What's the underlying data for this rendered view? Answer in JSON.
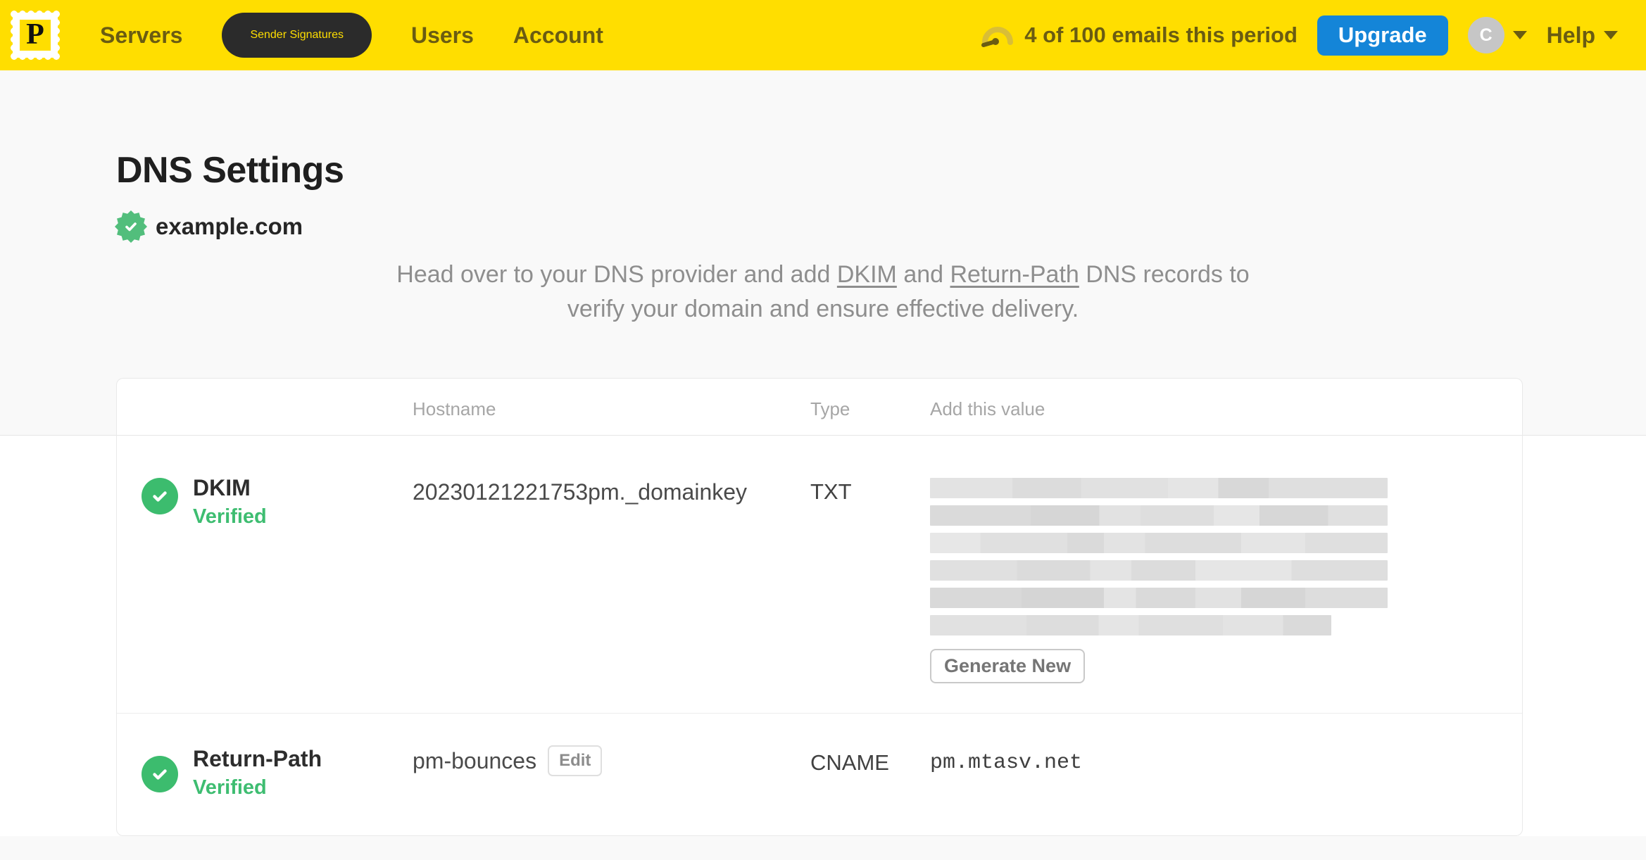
{
  "nav": {
    "logo_letter": "P",
    "items": [
      {
        "label": "Servers",
        "active": false
      },
      {
        "label": "Sender Signatures",
        "active": true
      },
      {
        "label": "Users",
        "active": false
      },
      {
        "label": "Account",
        "active": false
      }
    ],
    "usage_text": "4 of 100 emails this period",
    "upgrade_label": "Upgrade",
    "avatar_initial": "C",
    "help_label": "Help"
  },
  "page": {
    "title": "DNS Settings",
    "domain": "example.com",
    "intro": {
      "pre": "Head over to your DNS provider and add ",
      "link_dkim": "DKIM",
      "mid": " and ",
      "link_return_path": "Return-Path",
      "post": " DNS records to",
      "line2": "verify your domain and ensure effective delivery."
    }
  },
  "table": {
    "headers": {
      "hostname": "Hostname",
      "type": "Type",
      "value": "Add this value"
    },
    "records": [
      {
        "name": "DKIM",
        "status": "Verified",
        "hostname": "20230121221753pm._domainkey",
        "type": "TXT",
        "value_redacted": true,
        "redacted_lines": 6,
        "action": "Generate New"
      },
      {
        "name": "Return-Path",
        "status": "Verified",
        "hostname": "pm-bounces",
        "hostname_action": "Edit",
        "type": "CNAME",
        "value": "pm.mtasv.net"
      }
    ]
  },
  "colors": {
    "brand_yellow": "#FFDE00",
    "nav_text_olive": "#6A5C12",
    "active_pill_bg": "#2B2B2B",
    "upgrade_blue": "#1485D8",
    "success_green": "#3CBC6E",
    "verified_text_green": "#3EBD71",
    "page_bg": "#F9F9F9"
  }
}
